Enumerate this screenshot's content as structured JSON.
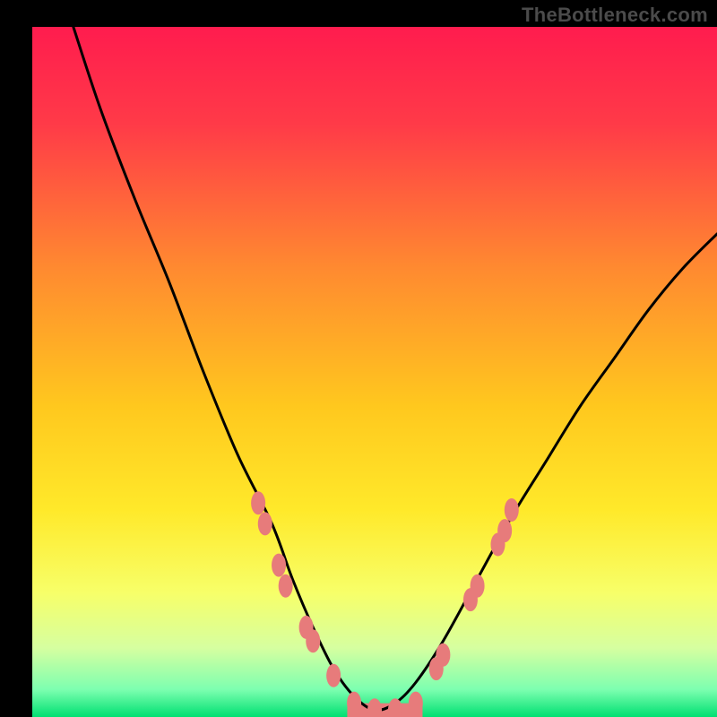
{
  "watermark": "TheBottleneck.com",
  "chart_data": {
    "type": "line",
    "title": "",
    "xlabel": "",
    "ylabel": "",
    "xlim": [
      0,
      100
    ],
    "ylim": [
      0,
      100
    ],
    "grid": false,
    "legend": false,
    "background_gradient": {
      "top_color": "#ff1c4e",
      "mid_color": "#ffd400",
      "bottom_color": "#00e072"
    },
    "series": [
      {
        "name": "bottleneck-curve",
        "color": "#000000",
        "x": [
          6,
          10,
          15,
          20,
          25,
          30,
          35,
          38,
          41,
          44,
          47,
          50,
          53,
          56,
          60,
          65,
          70,
          75,
          80,
          85,
          90,
          95,
          100
        ],
        "y": [
          100,
          88,
          75,
          63,
          50,
          38,
          28,
          20,
          13,
          7,
          3,
          1,
          2,
          5,
          11,
          20,
          29,
          37,
          45,
          52,
          59,
          65,
          70
        ]
      }
    ],
    "markers": {
      "name": "highlight-points",
      "color": "#e77b7b",
      "points": [
        {
          "x": 33,
          "y": 31
        },
        {
          "x": 34,
          "y": 28
        },
        {
          "x": 36,
          "y": 22
        },
        {
          "x": 37,
          "y": 19
        },
        {
          "x": 40,
          "y": 13
        },
        {
          "x": 41,
          "y": 11
        },
        {
          "x": 44,
          "y": 6
        },
        {
          "x": 47,
          "y": 2
        },
        {
          "x": 50,
          "y": 1
        },
        {
          "x": 53,
          "y": 1
        },
        {
          "x": 56,
          "y": 2
        },
        {
          "x": 59,
          "y": 7
        },
        {
          "x": 60,
          "y": 9
        },
        {
          "x": 64,
          "y": 17
        },
        {
          "x": 65,
          "y": 19
        },
        {
          "x": 68,
          "y": 25
        },
        {
          "x": 69,
          "y": 27
        },
        {
          "x": 70,
          "y": 30
        }
      ]
    },
    "flat_band": {
      "y_from": 0,
      "y_to": 2,
      "color": "#e77b7b"
    }
  }
}
